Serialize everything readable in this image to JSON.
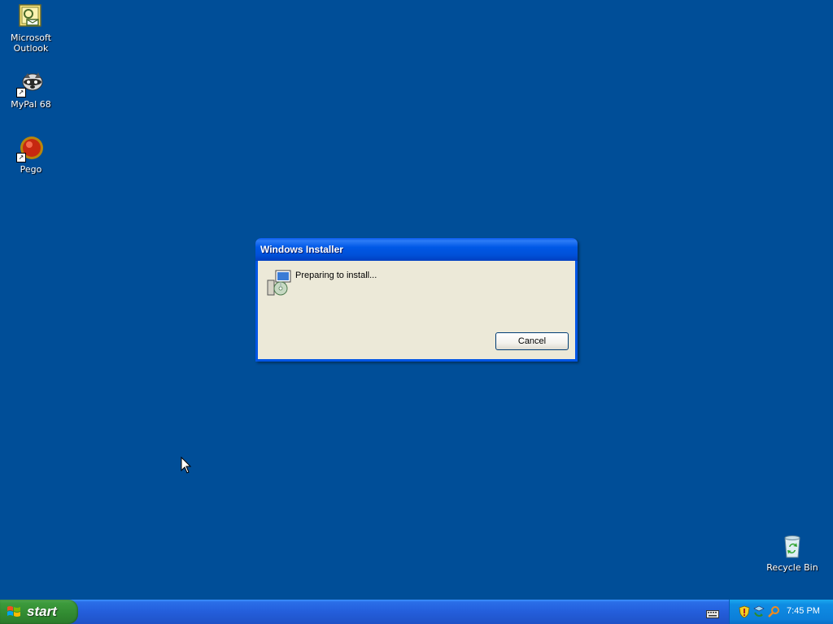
{
  "desktop": {
    "icons": [
      {
        "label": "Microsoft Outlook",
        "icon": "outlook-icon"
      },
      {
        "label": "MyPal 68",
        "icon": "mypal-icon"
      },
      {
        "label": "Pego",
        "icon": "pego-icon"
      },
      {
        "label": "Recycle Bin",
        "icon": "recycle-bin-icon"
      }
    ]
  },
  "dialog": {
    "title": "Windows Installer",
    "message": "Preparing to install...",
    "cancel_label": "Cancel"
  },
  "taskbar": {
    "start_label": "start",
    "clock": "7:45 PM"
  },
  "colors": {
    "desktop_bg": "#004e98",
    "dialog_body": "#ece9d8",
    "taskbar_blue": "#245edb",
    "start_green": "#3c9a3c",
    "tray_blue": "#0f8ce3"
  }
}
